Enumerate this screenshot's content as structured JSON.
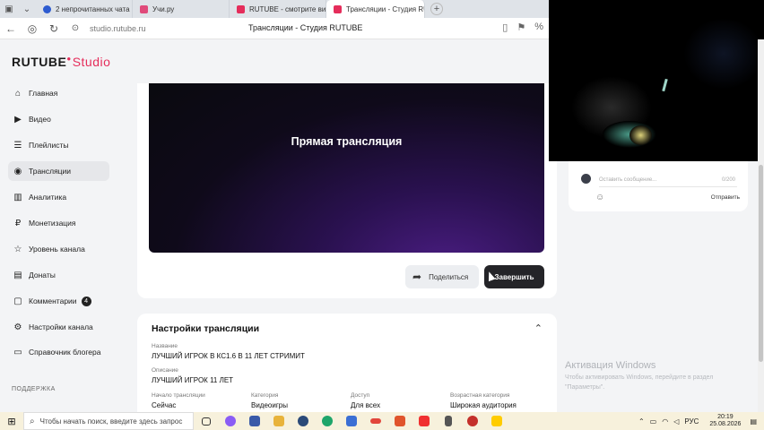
{
  "browser": {
    "tabs": [
      {
        "label": "2 непрочитанных чата",
        "color": "#2d5bd0"
      },
      {
        "label": "Учи.ру",
        "color": "#e04a7a"
      },
      {
        "label": "RUTUBE - смотрите видео",
        "color": "#e52d5b"
      },
      {
        "label": "Трансляции - Студия RUTU",
        "color": "#e52d5b",
        "active": true
      }
    ],
    "url": "studio.rutube.ru",
    "page_title": "Трансляции - Студия RUTUBE"
  },
  "logo": {
    "brand": "RUTUBE",
    "product": "Studio"
  },
  "sidebar": {
    "items": [
      {
        "label": "Главная",
        "icon": "home-icon",
        "glyph": "⌂"
      },
      {
        "label": "Видео",
        "icon": "video-icon",
        "glyph": "▶"
      },
      {
        "label": "Плейлисты",
        "icon": "playlist-icon",
        "glyph": "☰"
      },
      {
        "label": "Трансляции",
        "icon": "broadcast-icon",
        "glyph": "◉",
        "active": true
      },
      {
        "label": "Аналитика",
        "icon": "analytics-icon",
        "glyph": "▥"
      },
      {
        "label": "Монетизация",
        "icon": "ruble-icon",
        "glyph": "₽"
      },
      {
        "label": "Уровень канала",
        "icon": "star-icon",
        "glyph": "☆"
      },
      {
        "label": "Донаты",
        "icon": "donate-icon",
        "glyph": "▤"
      },
      {
        "label": "Комментарии",
        "icon": "comment-icon",
        "glyph": "▢",
        "badge": "4"
      },
      {
        "label": "Настройки канала",
        "icon": "gear-icon",
        "glyph": "⚙"
      },
      {
        "label": "Справочник блогера",
        "icon": "book-icon",
        "glyph": "▭"
      }
    ],
    "section": "ПОДДЕРЖКА"
  },
  "player": {
    "label": "Прямая трансляция"
  },
  "actions": {
    "share": "Поделиться",
    "end": "Завершить"
  },
  "settings": {
    "title": "Настройки трансляции",
    "name_label": "Название",
    "name_value": "ЛУЧШИЙ ИГРОК В КС1.6 В 11 ЛЕТ СТРИМИТ",
    "desc_label": "Описание",
    "desc_value": "ЛУЧШИЙ ИГРОК 11 ЛЕТ",
    "start_label": "Начало трансляции",
    "start_value": "Сейчас",
    "category_label": "Категория",
    "category_value": "Видеоигры",
    "access_label": "Доступ",
    "access_value": "Для всех",
    "age_label": "Возрастная категория",
    "age_value": "Широкая аудитория"
  },
  "chat": {
    "placeholder": "Оставить сообщение...",
    "counter": "0/200",
    "send": "Отправить"
  },
  "watermark": {
    "title": "Активация Windows",
    "subtitle": "Чтобы активировать Windows, перейдите в раздел \"Параметры\"."
  },
  "taskbar": {
    "search": "Чтобы начать поиск, введите здесь запрос",
    "lang": "РУС",
    "time": "20:19",
    "date": "25.08.2026"
  }
}
